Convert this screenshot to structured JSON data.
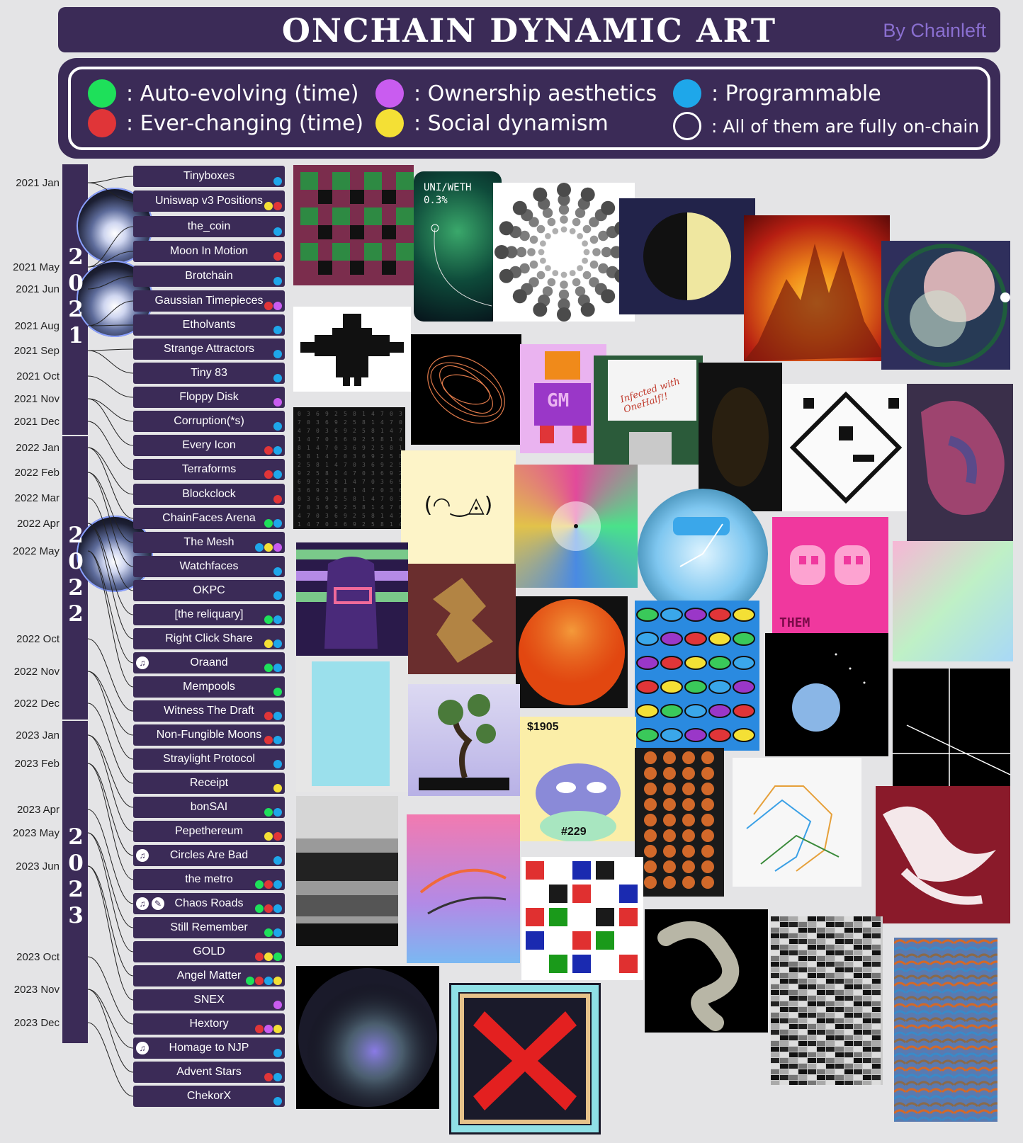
{
  "header": {
    "title": "ONCHAIN DYNAMIC ART",
    "byline": "By Chainleft"
  },
  "legend": [
    {
      "color": "#1ee05a",
      "label": ": Auto-evolving (time)"
    },
    {
      "color": "#e03538",
      "label": ": Ever-changing (time)"
    },
    {
      "color": "#c95cf0",
      "label": ": Ownership aesthetics"
    },
    {
      "color": "#f4e035",
      "label": ": Social dynamism"
    },
    {
      "color": "#1ea7ea",
      "label": ": Programmable"
    },
    {
      "color": "outline",
      "label": ": All of them are fully on-chain"
    }
  ],
  "years": [
    "2",
    "0",
    "2",
    "1",
    "2",
    "0",
    "2",
    "2",
    "2",
    "0",
    "2",
    "3"
  ],
  "months": [
    "2021 Jan",
    "2021 May",
    "2021 Jun",
    "2021 Aug",
    "2021 Sep",
    "2021 Oct",
    "2021 Nov",
    "2021 Dec",
    "2022 Jan",
    "2022 Feb",
    "2022 Mar",
    "2022 Apr",
    "2022 May",
    "2022 Oct",
    "2022 Nov",
    "2022 Dec",
    "2023 Jan",
    "2023 Feb",
    "2023 Apr",
    "2023 May",
    "2023 Jun",
    "2023 Oct",
    "2023 Nov",
    "2023 Dec"
  ],
  "projects": [
    {
      "name": "Tinyboxes",
      "tags": [
        "blue"
      ]
    },
    {
      "name": "Uniswap v3 Positions",
      "tags": [
        "yellow",
        "red"
      ]
    },
    {
      "name": "the_coin",
      "tags": [
        "blue"
      ]
    },
    {
      "name": "Moon In Motion",
      "tags": [
        "red"
      ]
    },
    {
      "name": "Brotchain",
      "tags": [
        "blue"
      ]
    },
    {
      "name": "Gaussian Timepieces",
      "tags": [
        "red",
        "purple"
      ]
    },
    {
      "name": "Etholvants",
      "tags": [
        "blue"
      ]
    },
    {
      "name": "Strange Attractors",
      "tags": [
        "blue"
      ]
    },
    {
      "name": "Tiny 83",
      "tags": [
        "blue"
      ]
    },
    {
      "name": "Floppy Disk",
      "tags": [
        "purple"
      ]
    },
    {
      "name": "Corruption(*s)",
      "tags": [
        "blue"
      ]
    },
    {
      "name": "Every Icon",
      "tags": [
        "red",
        "blue"
      ]
    },
    {
      "name": "Terraforms",
      "tags": [
        "red",
        "blue"
      ]
    },
    {
      "name": "Blockclock",
      "tags": [
        "red"
      ]
    },
    {
      "name": "ChainFaces Arena",
      "tags": [
        "green",
        "blue"
      ]
    },
    {
      "name": "The Mesh",
      "tags": [
        "blue",
        "yellow",
        "purple"
      ]
    },
    {
      "name": "Watchfaces",
      "tags": [
        "blue"
      ]
    },
    {
      "name": "OKPC",
      "tags": [
        "blue"
      ]
    },
    {
      "name": "[the reliquary]",
      "tags": [
        "green",
        "blue"
      ]
    },
    {
      "name": "Right Click Share",
      "tags": [
        "yellow",
        "blue"
      ]
    },
    {
      "name": "Oraand",
      "tags": [
        "green",
        "blue"
      ],
      "icons": [
        "♫"
      ]
    },
    {
      "name": "Mempools",
      "tags": [
        "green"
      ]
    },
    {
      "name": "Witness The Draft",
      "tags": [
        "red",
        "blue"
      ]
    },
    {
      "name": "Non-Fungible Moons",
      "tags": [
        "red",
        "blue"
      ]
    },
    {
      "name": "Straylight Protocol",
      "tags": [
        "blue"
      ]
    },
    {
      "name": "Receipt",
      "tags": [
        "yellow"
      ]
    },
    {
      "name": "bonSAI",
      "tags": [
        "green",
        "blue"
      ]
    },
    {
      "name": "Pepethereum",
      "tags": [
        "yellow",
        "red"
      ]
    },
    {
      "name": "Circles Are Bad",
      "tags": [
        "blue"
      ],
      "icons": [
        "♫"
      ]
    },
    {
      "name": "the metro",
      "tags": [
        "green",
        "red",
        "blue"
      ]
    },
    {
      "name": "Chaos Roads",
      "tags": [
        "green",
        "red",
        "blue"
      ],
      "icons": [
        "♫",
        "✎"
      ]
    },
    {
      "name": "Still Remember",
      "tags": [
        "green",
        "blue"
      ]
    },
    {
      "name": "GOLD",
      "tags": [
        "red",
        "yellow",
        "green"
      ]
    },
    {
      "name": "Angel Matter",
      "tags": [
        "green",
        "red",
        "blue",
        "yellow"
      ]
    },
    {
      "name": "SNEX",
      "tags": [
        "purple"
      ]
    },
    {
      "name": "Hextory",
      "tags": [
        "red",
        "purple",
        "yellow"
      ]
    },
    {
      "name": "Homage to NJP",
      "tags": [
        "blue"
      ],
      "icons": [
        "♫"
      ]
    },
    {
      "name": "Advent Stars",
      "tags": [
        "red",
        "blue"
      ]
    },
    {
      "name": "ChekorX",
      "tags": [
        "blue"
      ]
    }
  ],
  "artwork_text": {
    "uniswap_pair": "UNI/WETH",
    "uniswap_fee": "0.3%",
    "tiny83_label": "GM",
    "floppy_stamp": "Infected with OneHalf!!",
    "chainfaces_face": "(◠‿◬)",
    "pepe_price": "$1905",
    "pepe_id": "#229",
    "okpc_label": "THEM"
  },
  "tag_colors": {
    "green": "#1ee05a",
    "red": "#e03538",
    "purple": "#c95cf0",
    "yellow": "#f4e035",
    "blue": "#1ea7ea"
  }
}
